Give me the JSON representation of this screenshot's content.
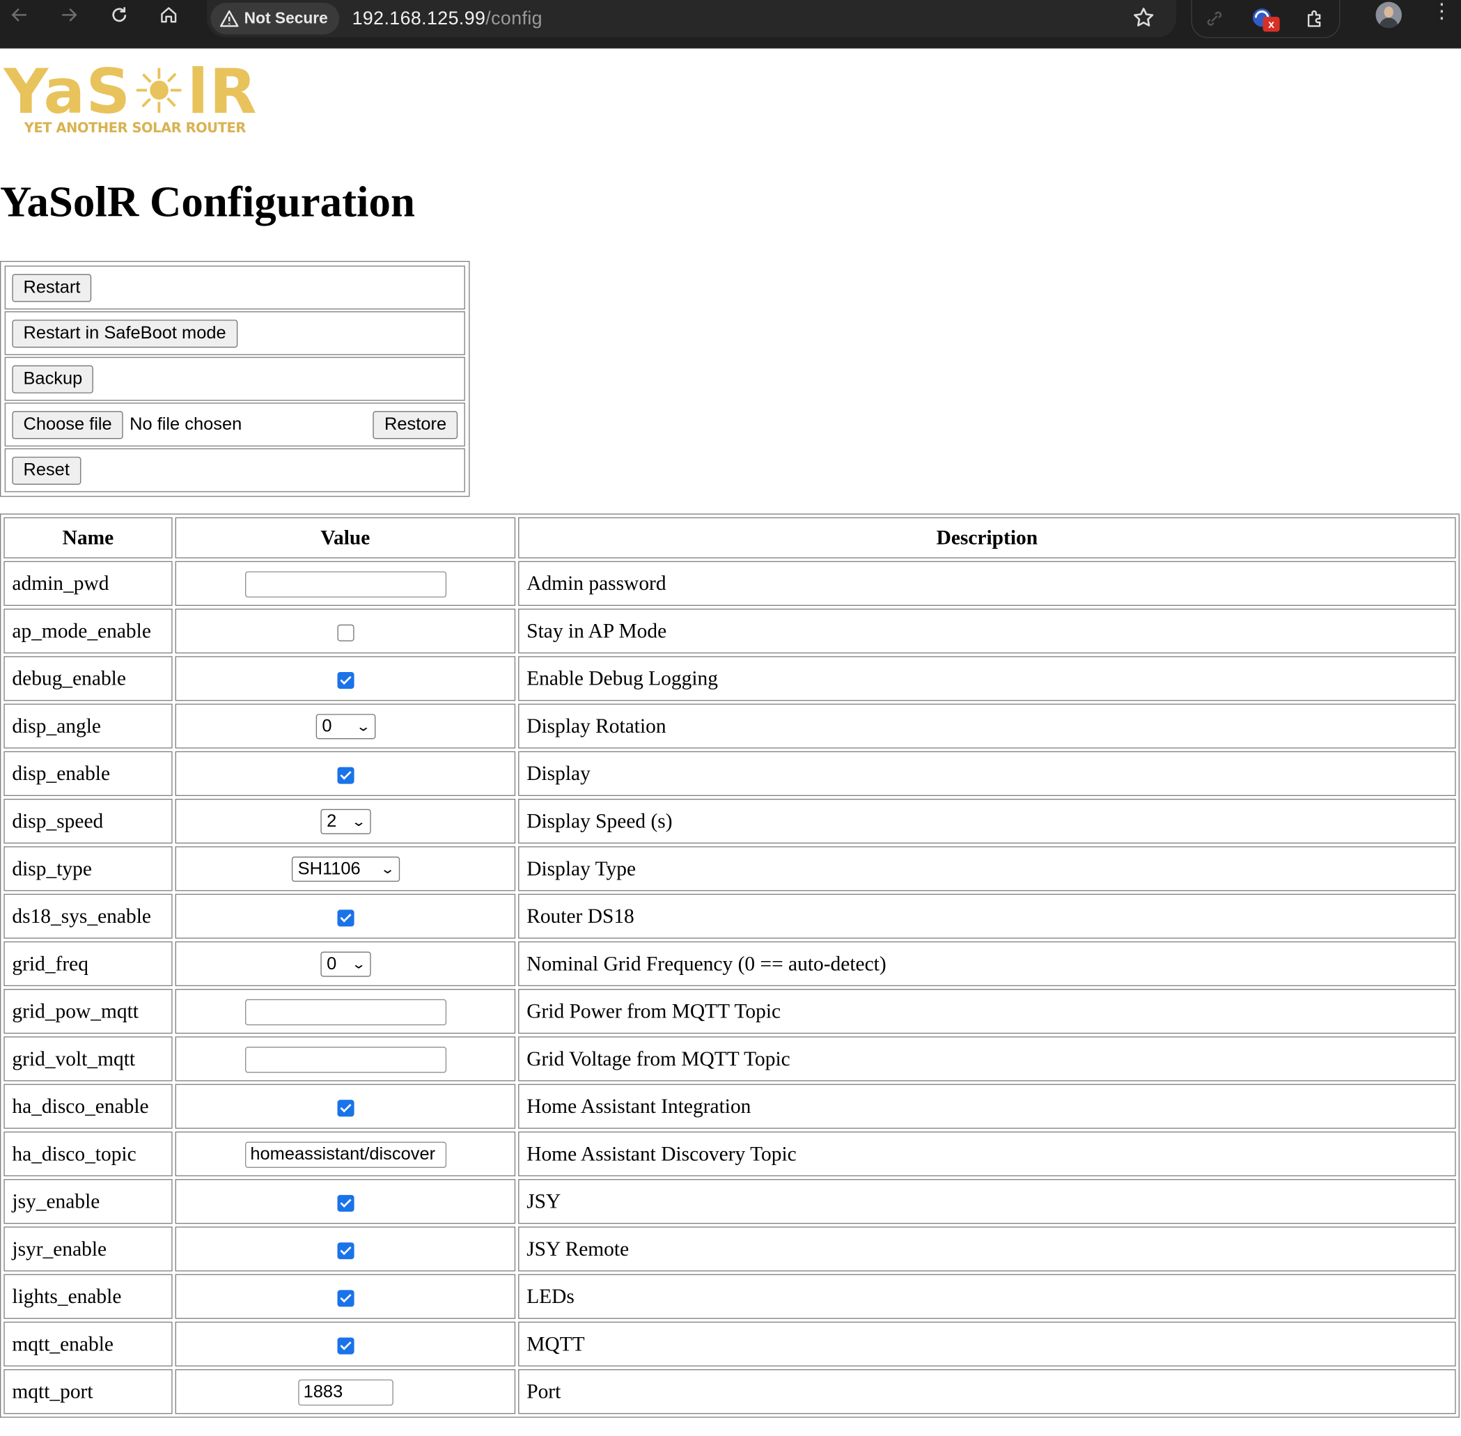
{
  "browser": {
    "security_label": "Not Secure",
    "url_host": "192.168.125.99",
    "url_path": "/config",
    "extension_badge": "x"
  },
  "logo": {
    "word": "YaS☀lR",
    "tagline": "YET ANOTHER SOLAR ROUTER"
  },
  "page_title": "YaSolR Configuration",
  "actions": {
    "restart": "Restart",
    "restart_safeboot": "Restart in SafeBoot mode",
    "backup": "Backup",
    "choose_file": "Choose file",
    "no_file": "No file chosen",
    "restore": "Restore",
    "reset": "Reset"
  },
  "table": {
    "headers": {
      "name": "Name",
      "value": "Value",
      "description": "Description"
    },
    "rows": [
      {
        "name": "admin_pwd",
        "type": "text",
        "value": "",
        "description": "Admin password"
      },
      {
        "name": "ap_mode_enable",
        "type": "checkbox",
        "checked": false,
        "description": "Stay in AP Mode"
      },
      {
        "name": "debug_enable",
        "type": "checkbox",
        "checked": true,
        "description": "Enable Debug Logging"
      },
      {
        "name": "disp_angle",
        "type": "select",
        "value": "0",
        "description": "Display Rotation"
      },
      {
        "name": "disp_enable",
        "type": "checkbox",
        "checked": true,
        "description": "Display"
      },
      {
        "name": "disp_speed",
        "type": "select",
        "value": "2",
        "description": "Display Speed (s)"
      },
      {
        "name": "disp_type",
        "type": "select",
        "value": "SH1106",
        "description": "Display Type"
      },
      {
        "name": "ds18_sys_enable",
        "type": "checkbox",
        "checked": true,
        "description": "Router DS18"
      },
      {
        "name": "grid_freq",
        "type": "select",
        "value": "0",
        "description": "Nominal Grid Frequency (0 == auto-detect)"
      },
      {
        "name": "grid_pow_mqtt",
        "type": "text",
        "value": "",
        "description": "Grid Power from MQTT Topic"
      },
      {
        "name": "grid_volt_mqtt",
        "type": "text",
        "value": "",
        "description": "Grid Voltage from MQTT Topic"
      },
      {
        "name": "ha_disco_enable",
        "type": "checkbox",
        "checked": true,
        "description": "Home Assistant Integration"
      },
      {
        "name": "ha_disco_topic",
        "type": "text",
        "value": "homeassistant/discover",
        "description": "Home Assistant Discovery Topic"
      },
      {
        "name": "jsy_enable",
        "type": "checkbox",
        "checked": true,
        "description": "JSY"
      },
      {
        "name": "jsyr_enable",
        "type": "checkbox",
        "checked": true,
        "description": "JSY Remote"
      },
      {
        "name": "lights_enable",
        "type": "checkbox",
        "checked": true,
        "description": "LEDs"
      },
      {
        "name": "mqtt_enable",
        "type": "checkbox",
        "checked": true,
        "description": "MQTT"
      },
      {
        "name": "mqtt_port",
        "type": "number",
        "value": "1883",
        "description": "Port"
      }
    ]
  }
}
